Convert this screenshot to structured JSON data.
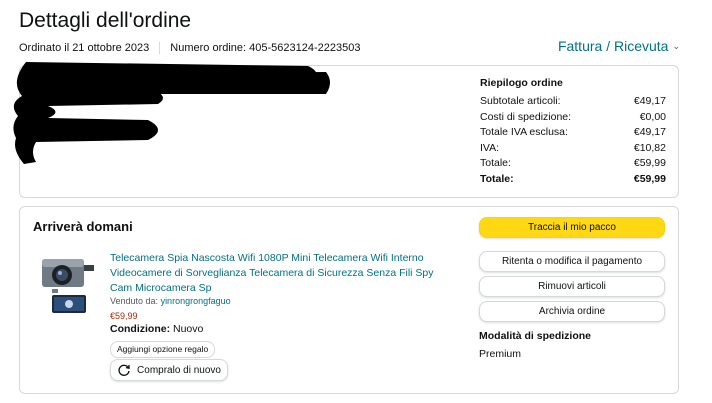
{
  "header": {
    "title": "Dettagli dell'ordine",
    "ordered_on": "Ordinato il 21 ottobre 2023",
    "order_number": "Numero ordine: 405-5623124-2223503",
    "invoice_label": "Fattura / Ricevuta"
  },
  "summary": {
    "title": "Riepilogo ordine",
    "rows": [
      {
        "label": "Subtotale articoli:",
        "value": "€49,17"
      },
      {
        "label": "Costi di spedizione:",
        "value": "€0,00"
      },
      {
        "label": "Totale IVA esclusa:",
        "value": "€49,17"
      },
      {
        "label": "IVA:",
        "value": "€10,82"
      },
      {
        "label": "Totale:",
        "value": "€59,99"
      },
      {
        "label": "Totale:",
        "value": "€59,99"
      }
    ]
  },
  "shipment": {
    "heading": "Arriverà domani",
    "product_title": "Telecamera Spia Nascosta Wifi 1080P Mini Telecamera Wifi Interno Videocamere di Sorveglianza Telecamera di Sicurezza Senza Fili Spy Cam Microcamera Sp",
    "seller_prefix": "Venduto da:",
    "seller_name": "yinrongrongfaguo",
    "price": "€59,99",
    "condition_label": "Condizione:",
    "condition_value": "Nuovo",
    "gift_button": "Aggiungi opzione regalo",
    "rebuy_button": "Compralo di nuovo"
  },
  "actions": {
    "track": "Traccia il mio pacco",
    "payment": "Ritenta o modifica il pagamento",
    "remove": "Rimuovi articoli",
    "archive": "Archivia ordine"
  },
  "shipping_method": {
    "label": "Modalità di spedizione",
    "value": "Premium"
  },
  "colors": {
    "link": "#007185",
    "primary_button": "#ffd814",
    "price": "#b12704"
  }
}
